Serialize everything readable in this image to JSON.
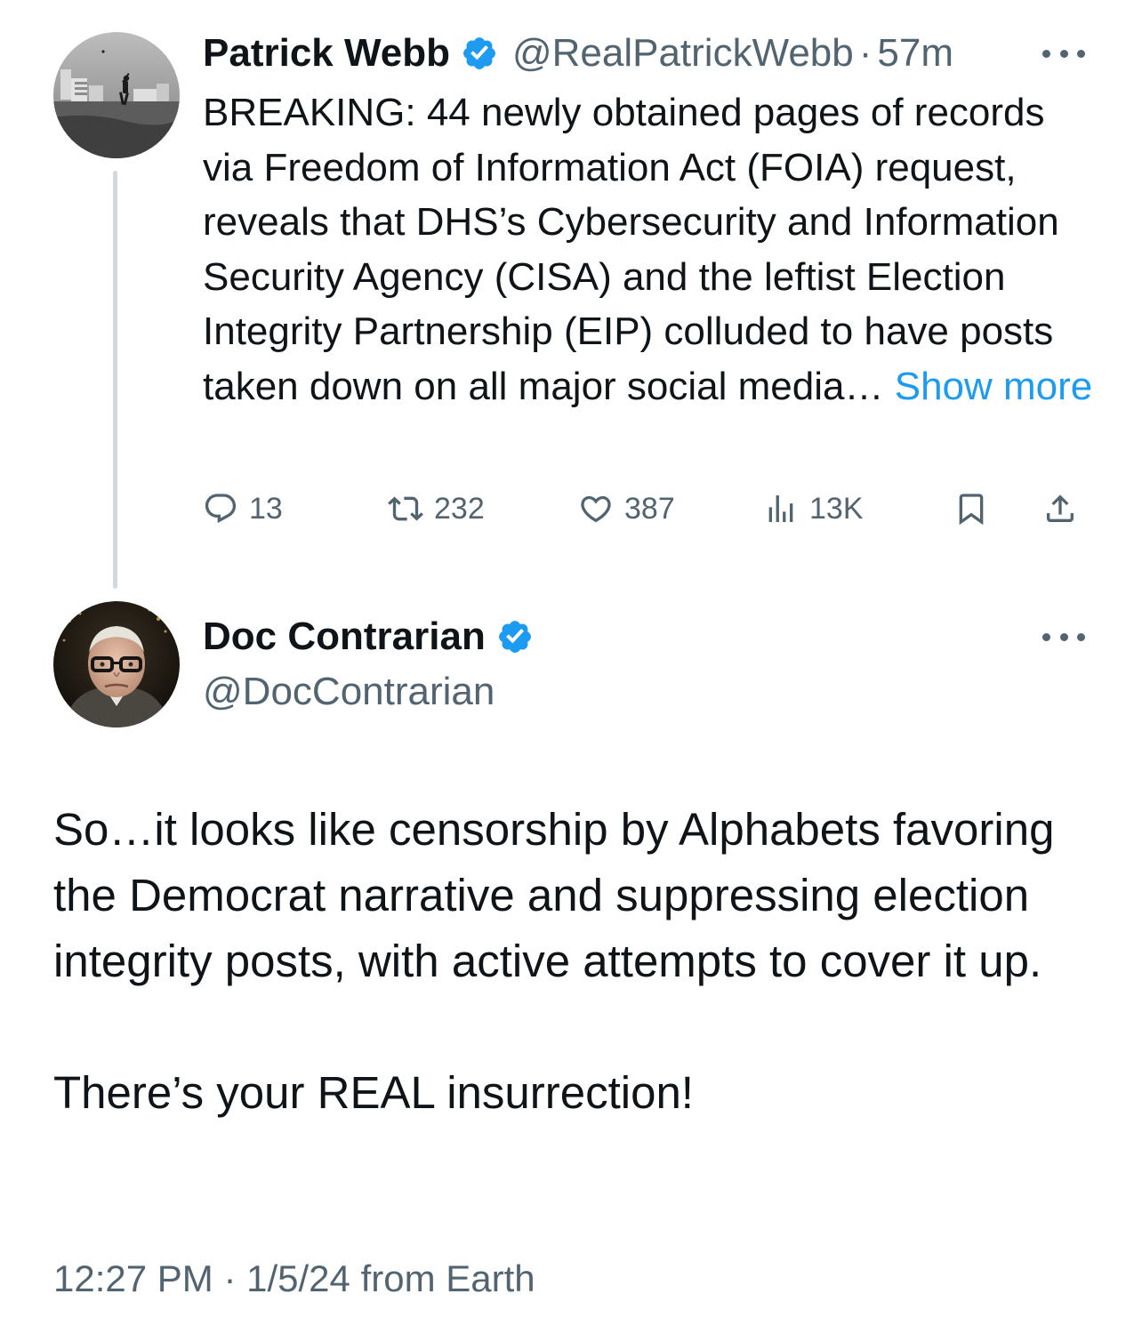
{
  "parent_tweet": {
    "display_name": "Patrick Webb",
    "handle": "@RealPatrickWebb",
    "separator": "·",
    "time": "57m",
    "body": "BREAKING: 44 newly obtained pages of records via Freedom of Information Act (FOIA) request, reveals that DHS’s Cybersecurity and Information Security Agency (CISA) and the leftist Election Integrity Partnership (EIP) colluded to have posts taken down on all major social media…",
    "show_more": "Show more",
    "actions": {
      "replies": "13",
      "retweets": "232",
      "likes": "387",
      "views": "13K"
    },
    "icons": [
      "more-icon",
      "verified-badge-icon",
      "reply-icon",
      "retweet-icon",
      "like-icon",
      "views-icon",
      "bookmark-icon",
      "share-icon"
    ]
  },
  "main_tweet": {
    "display_name": "Doc Contrarian",
    "handle": "@DocContrarian",
    "paragraph_1": "So…it looks like censorship by Alphabets favoring the Democrat narrative and suppressing election integrity posts, with active attempts to cover it up.",
    "paragraph_2": "There’s your REAL insurrection!",
    "time": "12:27 PM",
    "separator": "·",
    "date": "1/5/24",
    "source": "from Earth"
  },
  "colors": {
    "text_primary": "#0f1419",
    "text_secondary": "#536471",
    "link": "#1d9bf0",
    "verified": "#1d9bf0",
    "thread_line": "#cfd9de",
    "background": "#ffffff"
  }
}
